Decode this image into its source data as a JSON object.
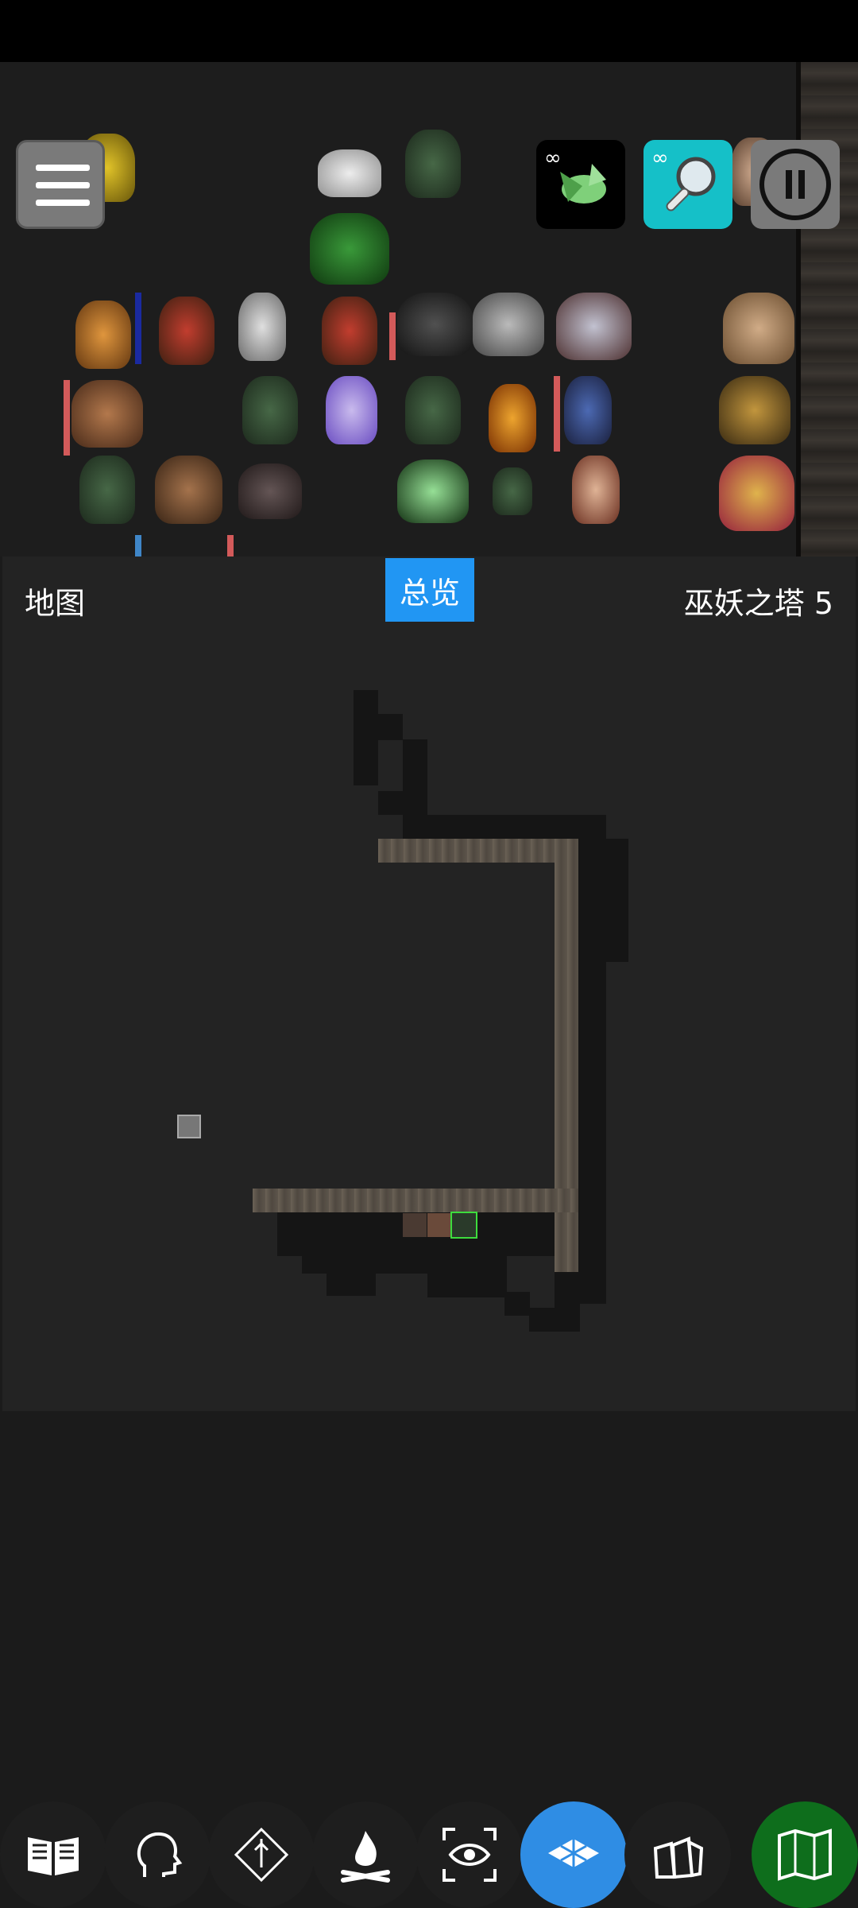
{
  "panel": {
    "title": "地图",
    "active_tab": "总览",
    "location": "巫妖之塔 5"
  },
  "hud": {
    "dragon_badge": "∞",
    "search_badge": "∞"
  },
  "colors": {
    "tab_active": "#2196f3",
    "nav_blue": "#2f8de4",
    "nav_green": "#0e6e1c",
    "hp_red": "#d35a5a",
    "hp_blue": "#3f86c8"
  },
  "bottom_nav": [
    {
      "icon": "book-icon"
    },
    {
      "icon": "head-profile-icon"
    },
    {
      "icon": "diamond-icon"
    },
    {
      "icon": "campfire-icon"
    },
    {
      "icon": "eye-focus-icon"
    },
    {
      "icon": "floor-tiles-icon"
    },
    {
      "icon": "gift-bags-icon"
    },
    {
      "icon": "folded-map-icon"
    }
  ]
}
